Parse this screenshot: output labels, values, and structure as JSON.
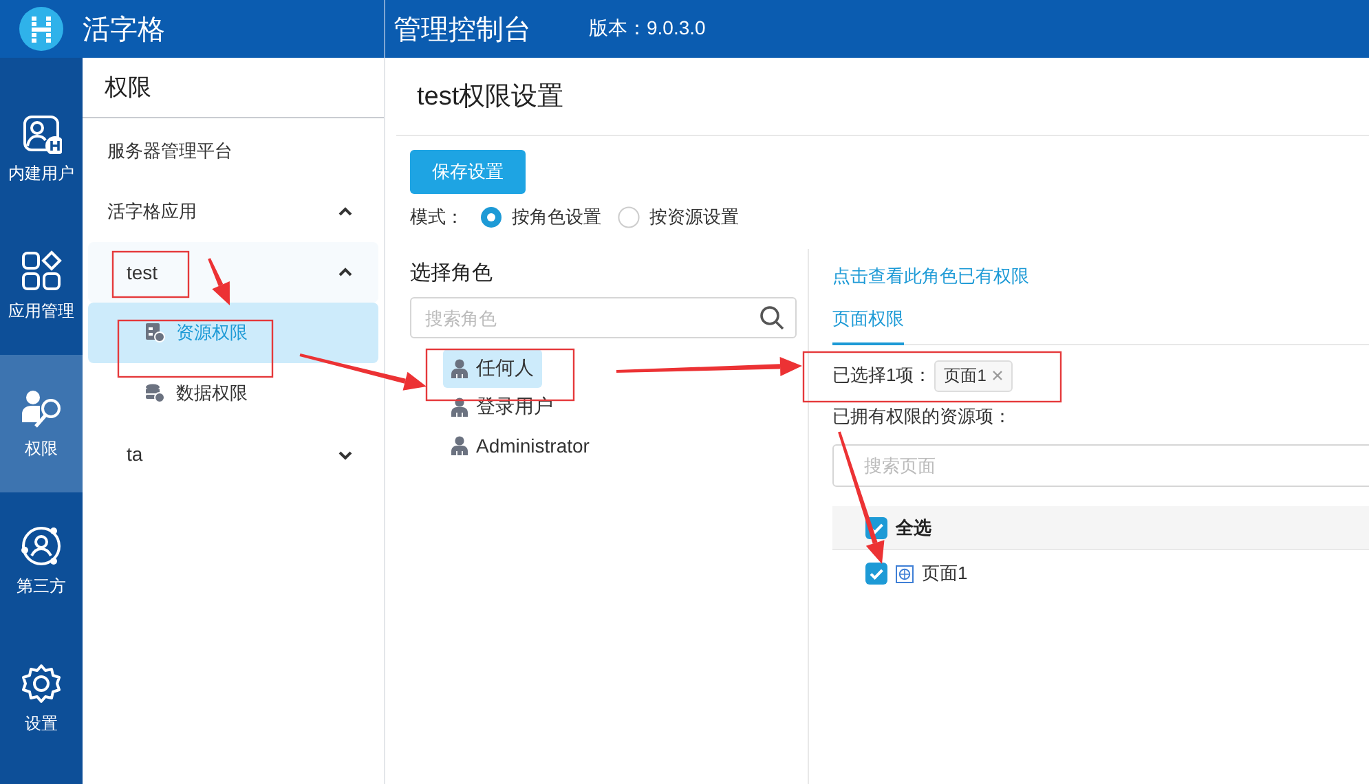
{
  "header": {
    "app_name": "活字格",
    "title": "管理控制台",
    "version": "版本：9.0.3.0"
  },
  "nav": [
    {
      "label": "内建用户",
      "kind": "users",
      "selected": false
    },
    {
      "label": "应用管理",
      "kind": "apps",
      "selected": false
    },
    {
      "label": "权限",
      "kind": "permissions",
      "selected": true
    },
    {
      "label": "第三方",
      "kind": "third-party",
      "selected": false
    },
    {
      "label": "设置",
      "kind": "settings",
      "selected": false
    }
  ],
  "sidebar": {
    "title": "权限",
    "items": [
      {
        "label": "服务器管理平台"
      },
      {
        "label": "活字格应用",
        "expanded": true,
        "children": [
          {
            "label": "test",
            "expanded": true,
            "children": [
              {
                "label": "资源权限",
                "kind": "resource",
                "selected": true
              },
              {
                "label": "数据权限",
                "kind": "data",
                "selected": false
              }
            ]
          },
          {
            "label": "ta",
            "expanded": false
          }
        ]
      }
    ]
  },
  "page": {
    "title": "test权限设置",
    "save_button": "保存设置",
    "mode_label": "模式：",
    "modes": [
      {
        "label": "按角色设置",
        "selected": true
      },
      {
        "label": "按资源设置",
        "selected": false
      }
    ],
    "roles": {
      "title": "选择角色",
      "search": {
        "placeholder": "搜索角色"
      },
      "items": [
        {
          "label": "任何人",
          "selected": true
        },
        {
          "label": "登录用户",
          "selected": false
        },
        {
          "label": "Administrator",
          "selected": false
        }
      ]
    },
    "permissions": {
      "link": "点击查看此角色已有权限",
      "tabs": [
        {
          "label": "页面权限",
          "selected": true
        }
      ],
      "selected_label": "已选择1项：",
      "selected_tags": [
        {
          "label": "页面1"
        }
      ],
      "owned_label": "已拥有权限的资源项：",
      "search": {
        "placeholder": "搜索页面"
      },
      "select_all": {
        "label": "全选",
        "checked": true
      },
      "items": [
        {
          "label": "页面1",
          "checked": true
        }
      ]
    }
  }
}
